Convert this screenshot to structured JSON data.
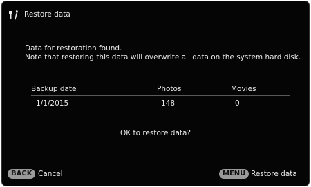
{
  "window": {
    "title": "Restore data",
    "icon": "restore-tools-icon"
  },
  "message": {
    "line1": "Data for restoration found.",
    "line2": "Note that restoring this data will overwrite all data on the system hard disk."
  },
  "table": {
    "headers": [
      "Backup date",
      "Photos",
      "Movies"
    ],
    "rows": [
      [
        "1/1/2015",
        "148",
        "0"
      ]
    ]
  },
  "prompt": "OK to restore data?",
  "footer": {
    "back_key": "BACK",
    "back_label": "Cancel",
    "menu_key": "MENU",
    "menu_label": "Restore data"
  }
}
